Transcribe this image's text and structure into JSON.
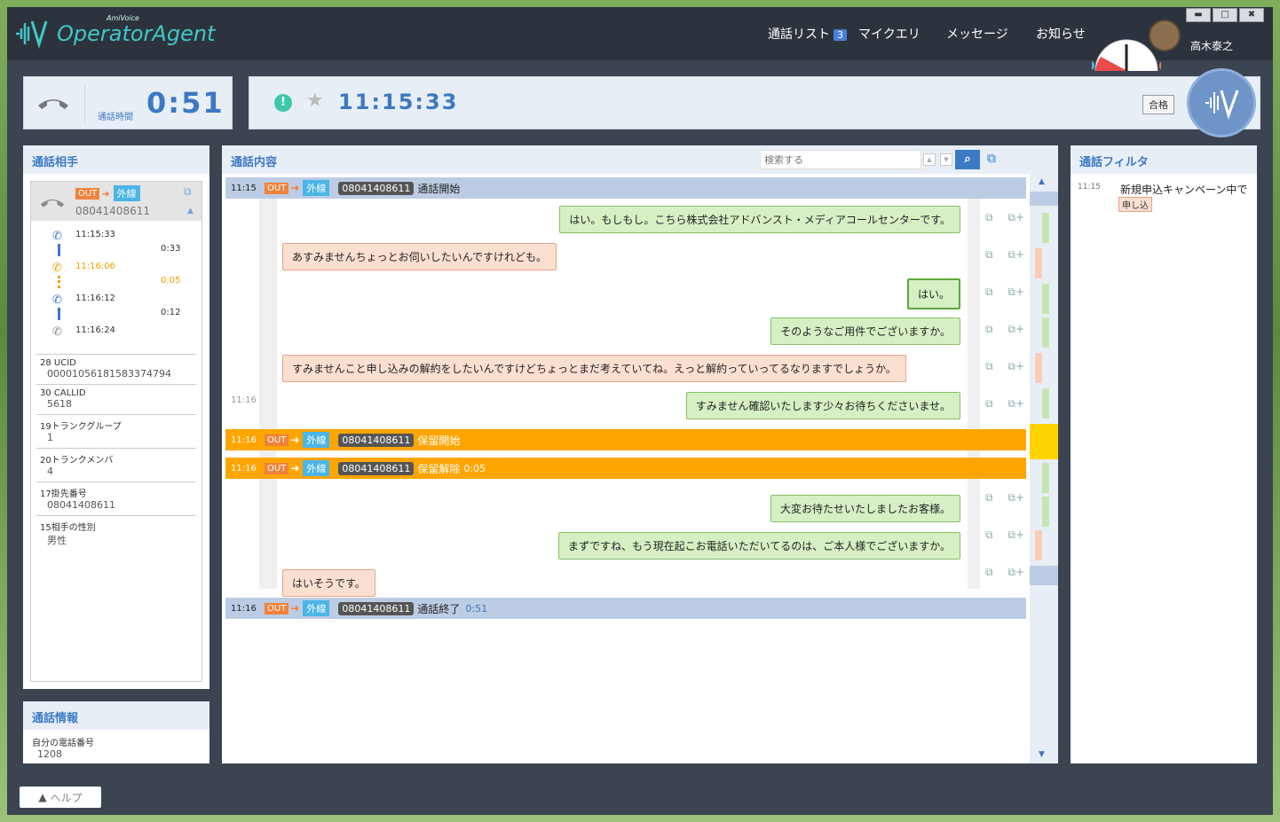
{
  "app": {
    "brand_small": "AmiVoice",
    "brand": "OperatorAgent"
  },
  "nav": {
    "call_list": "通話リスト",
    "call_list_count": "3",
    "my_query": "マイクエリ",
    "message": "メッセージ",
    "notice": "お知らせ"
  },
  "user": {
    "name": "高木泰之"
  },
  "window_buttons": {
    "minimize": "▬",
    "maximize": "□",
    "close": "✖"
  },
  "status": {
    "call_time_label": "通話時間",
    "call_time": "0:51",
    "clock": "11:15:33",
    "pass_button": "合格"
  },
  "partner": {
    "title": "通話相手",
    "out": "OUT",
    "gai": "外線",
    "number": "08041408611",
    "timeline": [
      {
        "time": "11:15:33",
        "dur": "0:33"
      },
      {
        "time": "11:16:06",
        "dur": "0:05"
      },
      {
        "time": "11:16:12",
        "dur": "0:12"
      },
      {
        "time": "11:16:24",
        "dur": ""
      }
    ],
    "fields": [
      {
        "k": "28 UCID",
        "v": "00001056181583374794"
      },
      {
        "k": "30 CALLID",
        "v": "5618"
      },
      {
        "k": "19トランクグループ",
        "v": "1"
      },
      {
        "k": "20トランクメンバ",
        "v": "4"
      },
      {
        "k": "17掛先番号",
        "v": "08041408611"
      },
      {
        "k": "15相手の性別",
        "v": "男性"
      }
    ]
  },
  "call_info": {
    "title": "通話情報",
    "k": "自分の電話番号",
    "v": "1208"
  },
  "content": {
    "title": "通話内容",
    "search_placeholder": "検索する",
    "events": {
      "start": {
        "time": "11:15",
        "label": "通話開始"
      },
      "hold": {
        "time": "11:16",
        "label": "保留開始"
      },
      "release": {
        "time": "11:16",
        "label": "保留解除",
        "extra": "0:05"
      },
      "end": {
        "time": "11:16",
        "label": "通話終了",
        "extra": "0:51"
      }
    },
    "side_time": "11:16",
    "messages": [
      "はい。もしもし。こちら株式会社アドバンスト・メディアコールセンターです。",
      "あすみませんちょっとお伺いしたいんですけれども。",
      "はい。",
      "そのようなご用件でございますか。",
      "すみませんこと申し込みの解約をしたいんですけどちょっとまだ考えていてね。えっと解約っていってるなりますでしょうか。",
      "すみません確認いたします少々お待ちくださいませ。",
      "大変お待たせいたしましたお客様。",
      "まずですね、もう現在起こお電話いただいてるのは、ご本人様でございますか。",
      "はいそうです。"
    ]
  },
  "filter": {
    "title": "通話フィルタ",
    "time": "11:15",
    "text": "新規申込キャンペーン中です！",
    "tag": "申し込"
  },
  "help": {
    "label": "ヘルプ"
  }
}
